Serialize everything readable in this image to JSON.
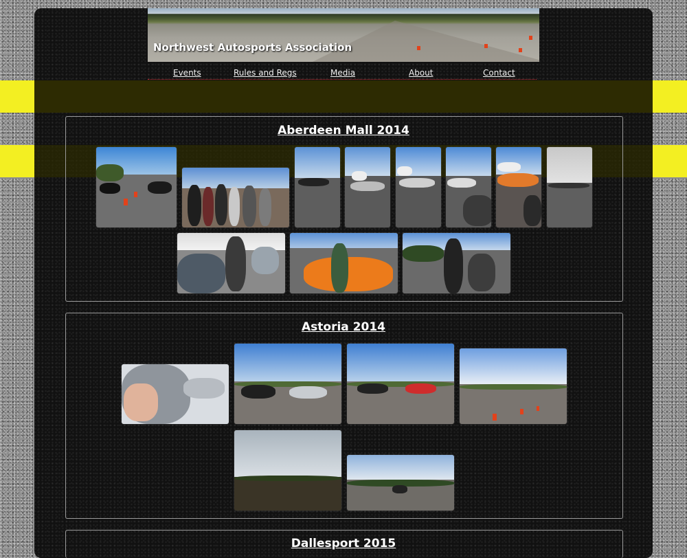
{
  "site": {
    "title": "Northwest Autosports Association"
  },
  "nav": {
    "items": [
      "Events",
      "Rules and Regs",
      "Media",
      "About",
      "Contact"
    ]
  },
  "galleries": [
    {
      "title": "Aberdeen Mall 2014"
    },
    {
      "title": "Astoria 2014"
    },
    {
      "title": "Dallesport 2015"
    }
  ],
  "colors": {
    "stripe": "#f3ef22",
    "panel": "#111111",
    "link": "#f2f2f2",
    "nav_divider": "#cc3333"
  },
  "icons": {
    "photo_thumbnails": "photo-thumbnail"
  }
}
